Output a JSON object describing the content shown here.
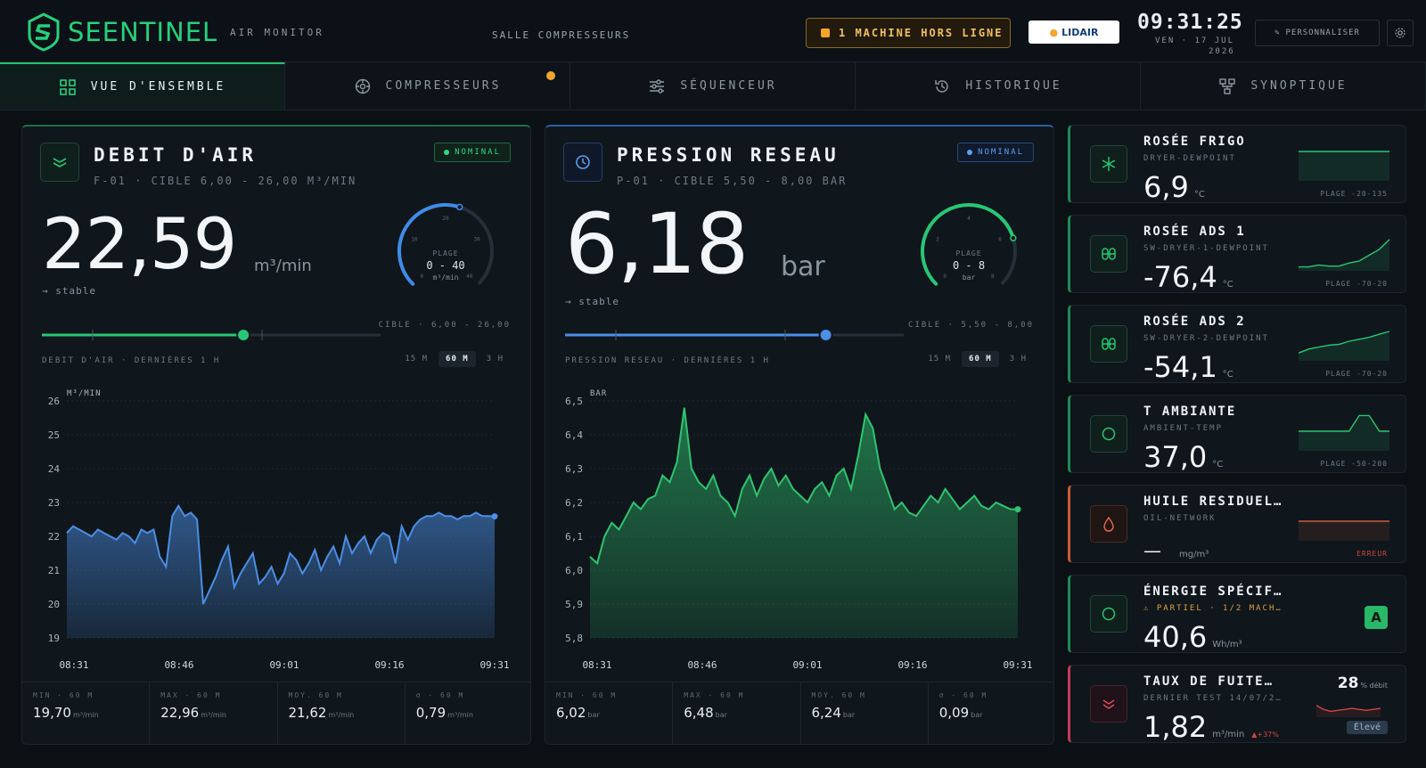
{
  "header": {
    "brand": "SEENTINEL",
    "app": "AIR MONITOR",
    "room": "SALLE COMPRESSEURS",
    "alert": "1 MACHINE HORS LIGNE",
    "partner": "LIDAIR",
    "time": "09:31:25",
    "date_line1": "VEN · 17 JUL",
    "date_line2": "2026",
    "customize": "PERSONNALISER"
  },
  "tabs": [
    {
      "label": "VUE D'ENSEMBLE",
      "icon": "grid-icon"
    },
    {
      "label": "COMPRESSEURS",
      "icon": "compressor-icon"
    },
    {
      "label": "SÉQUENCEUR",
      "icon": "sliders-icon"
    },
    {
      "label": "HISTORIQUE",
      "icon": "history-icon"
    },
    {
      "label": "SYNOPTIQUE",
      "icon": "network-icon"
    }
  ],
  "flow": {
    "title": "DEBIT D'AIR",
    "subtitle": "F-01 · CIBLE 6,00 - 26,00 M³/MIN",
    "status": "NOMINAL",
    "value": "22,59",
    "unit": "m³/min",
    "trend": "→ stable",
    "gauge_label": "PLAGE",
    "gauge_range": "0 - 40",
    "gauge_unit": "m³/min",
    "gauge_ticks": [
      "0",
      "10",
      "20",
      "30",
      "40"
    ],
    "gauge_fraction": 0.565,
    "slider_fraction": 0.595,
    "target": "CIBLE · 6,00 - 26,00",
    "chart_title": "DEBIT D'AIR · DERNIÈRES 1 H",
    "ranges": [
      "15 M",
      "60 M",
      "3 H"
    ],
    "stats": [
      {
        "label": "MIN · 60 M",
        "value": "19,70",
        "unit": "m³/min"
      },
      {
        "label": "MAX · 60 M",
        "value": "22,96",
        "unit": "m³/min"
      },
      {
        "label": "MOY. 60 M",
        "value": "21,62",
        "unit": "m³/min"
      },
      {
        "label": "σ · 60 M",
        "value": "0,79",
        "unit": "m³/min"
      }
    ]
  },
  "pressure": {
    "title": "PRESSION RESEAU",
    "subtitle": "P-01 · CIBLE 5,50 - 8,00 BAR",
    "status": "NOMINAL",
    "value": "6,18",
    "unit": "bar",
    "trend": "→ stable",
    "gauge_label": "PLAGE",
    "gauge_range": "0 - 8",
    "gauge_unit": "bar",
    "gauge_ticks": [
      "0",
      "2",
      "4",
      "6",
      "8"
    ],
    "gauge_fraction": 0.772,
    "slider_fraction": 0.77,
    "target": "CIBLE · 5,50 - 8,00",
    "chart_title": "PRESSION RESEAU · DERNIÈRES 1 H",
    "ranges": [
      "15 M",
      "60 M",
      "3 H"
    ],
    "stats": [
      {
        "label": "MIN · 60 M",
        "value": "6,02",
        "unit": "bar"
      },
      {
        "label": "MAX · 60 M",
        "value": "6,48",
        "unit": "bar"
      },
      {
        "label": "MOY. 60 M",
        "value": "6,24",
        "unit": "bar"
      },
      {
        "label": "σ · 60 M",
        "value": "0,09",
        "unit": "bar"
      }
    ]
  },
  "chart_data": [
    {
      "type": "area",
      "ylabel": "M³/MIN",
      "ylim": [
        19,
        26
      ],
      "yticks": [
        "19",
        "20",
        "21",
        "22",
        "23",
        "24",
        "25",
        "26"
      ],
      "xticks": [
        "08:31",
        "08:46",
        "09:01",
        "09:16",
        "09:31"
      ],
      "color": "#4b8fe6",
      "values": [
        22.1,
        22.3,
        22.2,
        22.1,
        22.0,
        22.2,
        22.1,
        22.0,
        21.9,
        22.1,
        22.0,
        21.8,
        22.2,
        22.1,
        22.2,
        21.4,
        21.1,
        22.6,
        22.9,
        22.6,
        22.7,
        22.5,
        20.0,
        20.4,
        20.8,
        21.3,
        21.7,
        20.5,
        20.9,
        21.2,
        21.5,
        20.6,
        20.8,
        21.1,
        20.6,
        20.9,
        21.5,
        21.3,
        20.9,
        21.2,
        21.6,
        21.0,
        21.4,
        21.7,
        21.2,
        22.0,
        21.5,
        21.8,
        22.0,
        21.5,
        21.9,
        22.1,
        22.0,
        21.2,
        22.3,
        21.9,
        22.3,
        22.5,
        22.6,
        22.6,
        22.7,
        22.6,
        22.6,
        22.5,
        22.6,
        22.6,
        22.7,
        22.6,
        22.6,
        22.59
      ]
    },
    {
      "type": "area",
      "ylabel": "BAR",
      "ylim": [
        5.8,
        6.5
      ],
      "yticks": [
        "5,8",
        "5,9",
        "6,0",
        "6,1",
        "6,2",
        "6,3",
        "6,4",
        "6,5"
      ],
      "xticks": [
        "08:31",
        "08:46",
        "09:01",
        "09:16",
        "09:31"
      ],
      "color": "#2fc46f",
      "values": [
        6.04,
        6.02,
        6.1,
        6.14,
        6.12,
        6.16,
        6.2,
        6.18,
        6.21,
        6.22,
        6.28,
        6.26,
        6.32,
        6.48,
        6.3,
        6.26,
        6.24,
        6.28,
        6.22,
        6.2,
        6.16,
        6.24,
        6.28,
        6.22,
        6.27,
        6.3,
        6.25,
        6.28,
        6.24,
        6.22,
        6.2,
        6.24,
        6.26,
        6.22,
        6.28,
        6.3,
        6.24,
        6.34,
        6.46,
        6.42,
        6.3,
        6.24,
        6.18,
        6.2,
        6.17,
        6.16,
        6.19,
        6.22,
        6.2,
        6.24,
        6.21,
        6.18,
        6.2,
        6.22,
        6.19,
        6.18,
        6.2,
        6.19,
        6.18,
        6.18
      ]
    }
  ],
  "sensors": [
    {
      "title": "ROSÉE FRIGO",
      "sub": "DRYER-DEWPOINT",
      "value": "6,9",
      "unit": "°C",
      "plage": "PLAGE -20-135",
      "icon": "snowflake-icon",
      "spark": [
        0.75,
        0.75,
        0.75,
        0.75,
        0.75,
        0.75,
        0.75,
        0.75,
        0.75,
        0.75
      ]
    },
    {
      "title": "ROSÉE ADS 1",
      "sub": "SW-DRYER-1-DEWPOINT",
      "value": "-76,4",
      "unit": "°C",
      "plage": "PLAGE -70-20",
      "icon": "filter-icon",
      "spark": [
        0.1,
        0.1,
        0.15,
        0.12,
        0.12,
        0.2,
        0.25,
        0.4,
        0.55,
        0.8
      ]
    },
    {
      "title": "ROSÉE ADS 2",
      "sub": "SW-DRYER-2-DEWPOINT",
      "value": "-54,1",
      "unit": "°C",
      "plage": "PLAGE -70-20",
      "icon": "filter-icon",
      "spark": [
        0.2,
        0.3,
        0.35,
        0.4,
        0.42,
        0.5,
        0.55,
        0.6,
        0.68,
        0.75
      ]
    },
    {
      "title": "T AMBIANTE",
      "sub": "AMBIENT-TEMP",
      "value": "37,0",
      "unit": "°C",
      "plage": "PLAGE -50-200",
      "icon": "circle-icon",
      "spark": [
        0.5,
        0.5,
        0.5,
        0.5,
        0.5,
        0.5,
        0.9,
        0.9,
        0.5,
        0.5
      ]
    },
    {
      "title": "HUILE RESIDUEL…",
      "sub": "OIL-NETWORK",
      "value": "—",
      "unit": "mg/m³",
      "status": "ERREUR",
      "icon": "drop-icon",
      "spark": [
        0.5,
        0.5,
        0.5,
        0.5,
        0.5,
        0.5,
        0.5,
        0.5,
        0.5,
        0.5
      ]
    },
    {
      "title": "ÉNERGIE SPÉCIF…",
      "sub": "⚠ PARTIEL · 1/2 MACH…",
      "value": "40,6",
      "unit": "Wh/m³",
      "grade": "A",
      "icon": "circle-icon"
    },
    {
      "title": "TAUX DE FUITE…",
      "sub": "DERNIER TEST 14/07/2…",
      "value": "1,82",
      "unit": "m³/min",
      "delta": "▲+37%",
      "pct": "28",
      "pct_unit": "% débit",
      "level": "Élevé",
      "icon": "chevrons-down-icon",
      "spark": [
        0.6,
        0.4,
        0.3,
        0.35,
        0.4,
        0.45,
        0.4,
        0.35,
        0.4,
        0.45
      ]
    }
  ],
  "colors": {
    "accent": "#22c46f",
    "blue": "#4b8fe6",
    "warn": "#f3a52c",
    "error": "#d0463e"
  }
}
